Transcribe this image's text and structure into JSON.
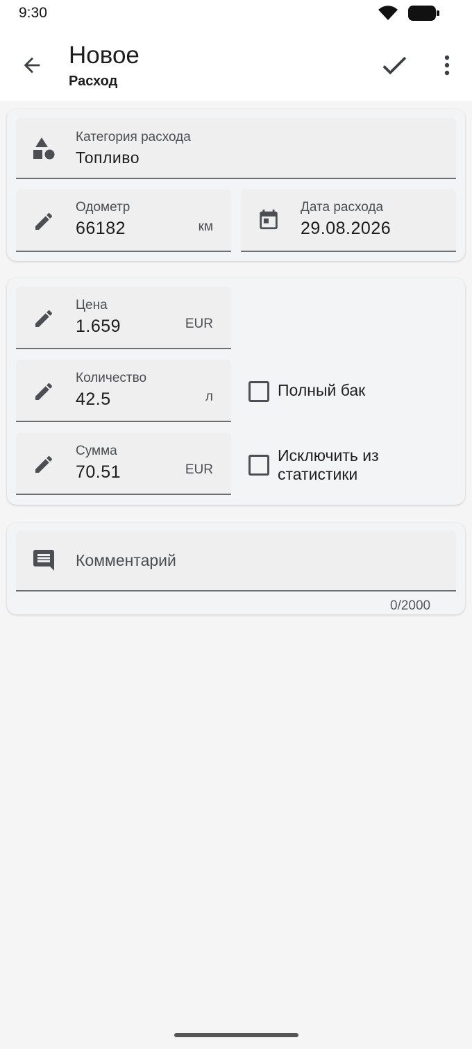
{
  "status_bar": {
    "time": "9:30",
    "icons": [
      "wifi-icon",
      "battery-icon"
    ]
  },
  "app_bar": {
    "title": "Новое",
    "subtitle": "Расход",
    "icons": [
      "arrow-back-icon",
      "check-icon",
      "more-vert-icon"
    ]
  },
  "general_card": {
    "category": {
      "label": "Категория расхода",
      "value": "Топливо",
      "icon": "category-shapes-icon"
    },
    "odometer": {
      "label": "Одометр",
      "value": "66182",
      "suffix": "км",
      "icon": "pencil-icon"
    },
    "date": {
      "label": "Дата расхода",
      "value": "29.08.2026",
      "icon": "calendar-icon"
    }
  },
  "fuel_card": {
    "price": {
      "label": "Цена",
      "value": "1.659",
      "suffix": "EUR",
      "icon": "pencil-icon"
    },
    "quantity": {
      "label": "Количество",
      "value": "42.5",
      "suffix": "л",
      "icon": "pencil-icon"
    },
    "total": {
      "label": "Сумма",
      "value": "70.51",
      "suffix": "EUR",
      "icon": "pencil-icon"
    },
    "full_tank": {
      "label": "Полный бак",
      "checked": false
    },
    "exclude_stats": {
      "label_line1": "Исключить из",
      "label_line2": "статистики",
      "checked": false
    }
  },
  "comment_card": {
    "placeholder": "Комментарий",
    "counter": "0/2000",
    "icon": "comment-icon"
  },
  "colors": {
    "icon": "#4b4e53",
    "card": "#f3f4f6",
    "field": "#efefef",
    "underline": "#6d6f72"
  }
}
